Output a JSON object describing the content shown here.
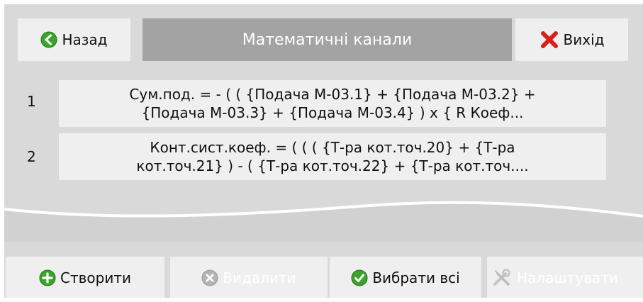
{
  "header": {
    "back_label": "Назад",
    "title": "Математичні канали",
    "exit_label": "Вихід"
  },
  "rows": [
    {
      "num": "1",
      "line1": "Сум.под. = - ( ( {Подача М-03.1} + {Подача М-03.2} +",
      "line2": "{Подача М-03.3} + {Подача М-03.4} ) x { R Коеф..."
    },
    {
      "num": "2",
      "line1": "Конт.сист.коеф. = ( ( ( {Т-ра кот.точ.20} + {Т-ра",
      "line2": "кот.точ.21} ) - ( {Т-ра кот.точ.22} + {Т-ра кот.точ...."
    }
  ],
  "footer": {
    "create_label": "Створити",
    "delete_label": "Видалити",
    "select_all_label": "Вибрати всі",
    "settings_label": "Налаштувати"
  },
  "colors": {
    "background": "#d9d9d9",
    "button": "#efefef",
    "title_bar": "#a3a3a3",
    "green": "#3aa52c",
    "red": "#d8201b",
    "disabled": "#ffffff"
  }
}
